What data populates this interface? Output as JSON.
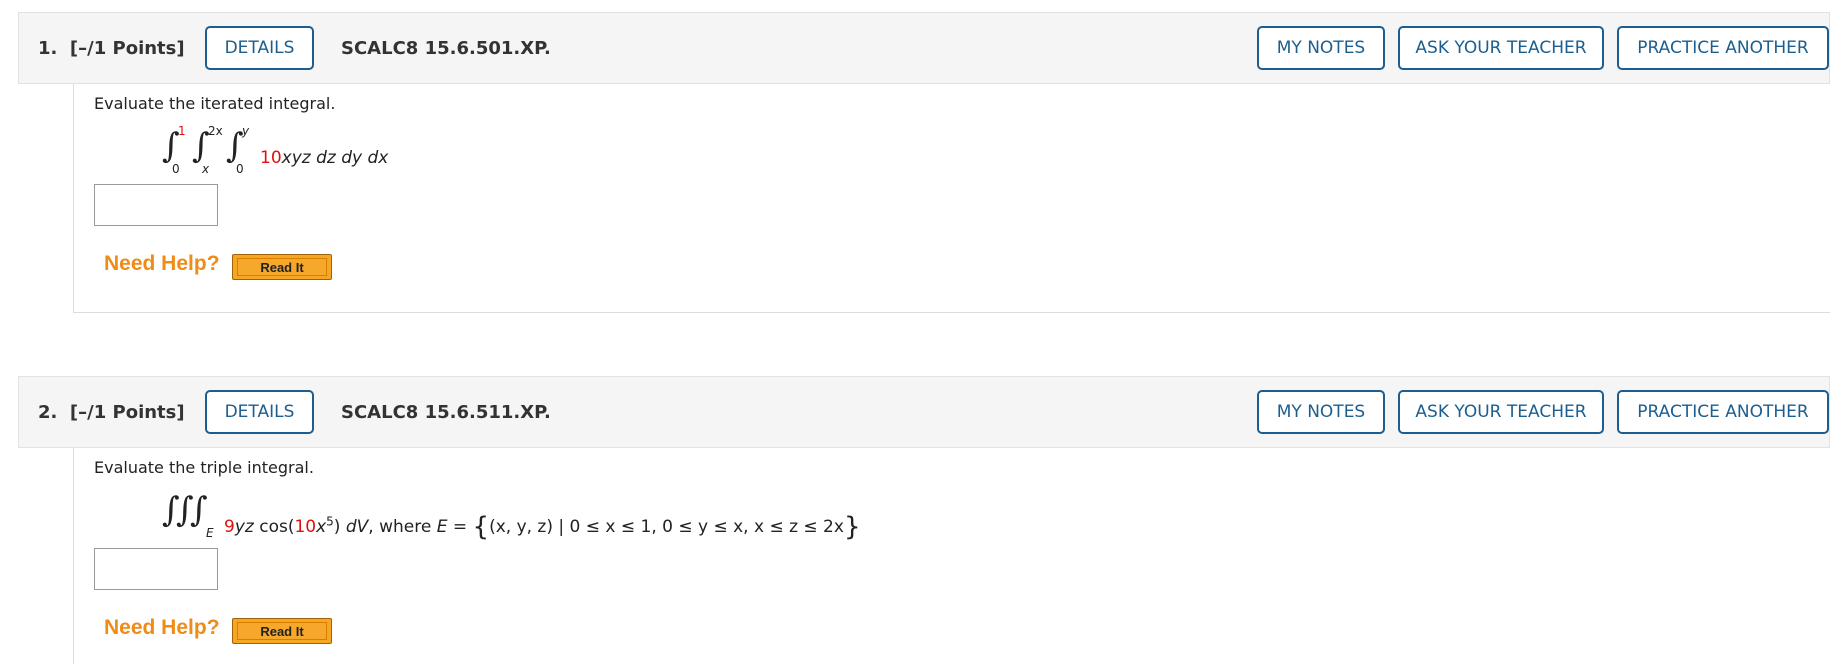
{
  "questions": [
    {
      "number": "1.",
      "points": "[–/1 Points]",
      "details_label": "DETAILS",
      "code": "SCALC8 15.6.501.XP.",
      "my_notes_label": "MY NOTES",
      "ask_teacher_label": "ASK YOUR TEACHER",
      "practice_label": "PRACTICE ANOTHER",
      "prompt": "Evaluate the iterated integral.",
      "math": {
        "upper1": "1",
        "lower1": "0",
        "upper2": "2x",
        "lower2": "x",
        "upper3": "y",
        "lower3": "0",
        "coef": "10",
        "integrand": "xyz dz dy dx"
      },
      "answer_value": "",
      "need_help": "Need Help?",
      "read_it": "Read It"
    },
    {
      "number": "2.",
      "points": "[–/1 Points]",
      "details_label": "DETAILS",
      "code": "SCALC8 15.6.511.XP.",
      "my_notes_label": "MY NOTES",
      "ask_teacher_label": "ASK YOUR TEACHER",
      "practice_label": "PRACTICE ANOTHER",
      "prompt": "Evaluate the triple integral.",
      "math": {
        "region": "E",
        "coef": "9",
        "part1": "yz cos(",
        "coef2": "10",
        "part2": "x",
        "exp": "5",
        "part3": ") dV, where E = ",
        "set": "(x, y, z) | 0 ≤ x ≤ 1, 0 ≤ y ≤ x, x ≤ z ≤ 2x"
      },
      "answer_value": "",
      "need_help": "Need Help?",
      "read_it": "Read It"
    }
  ]
}
